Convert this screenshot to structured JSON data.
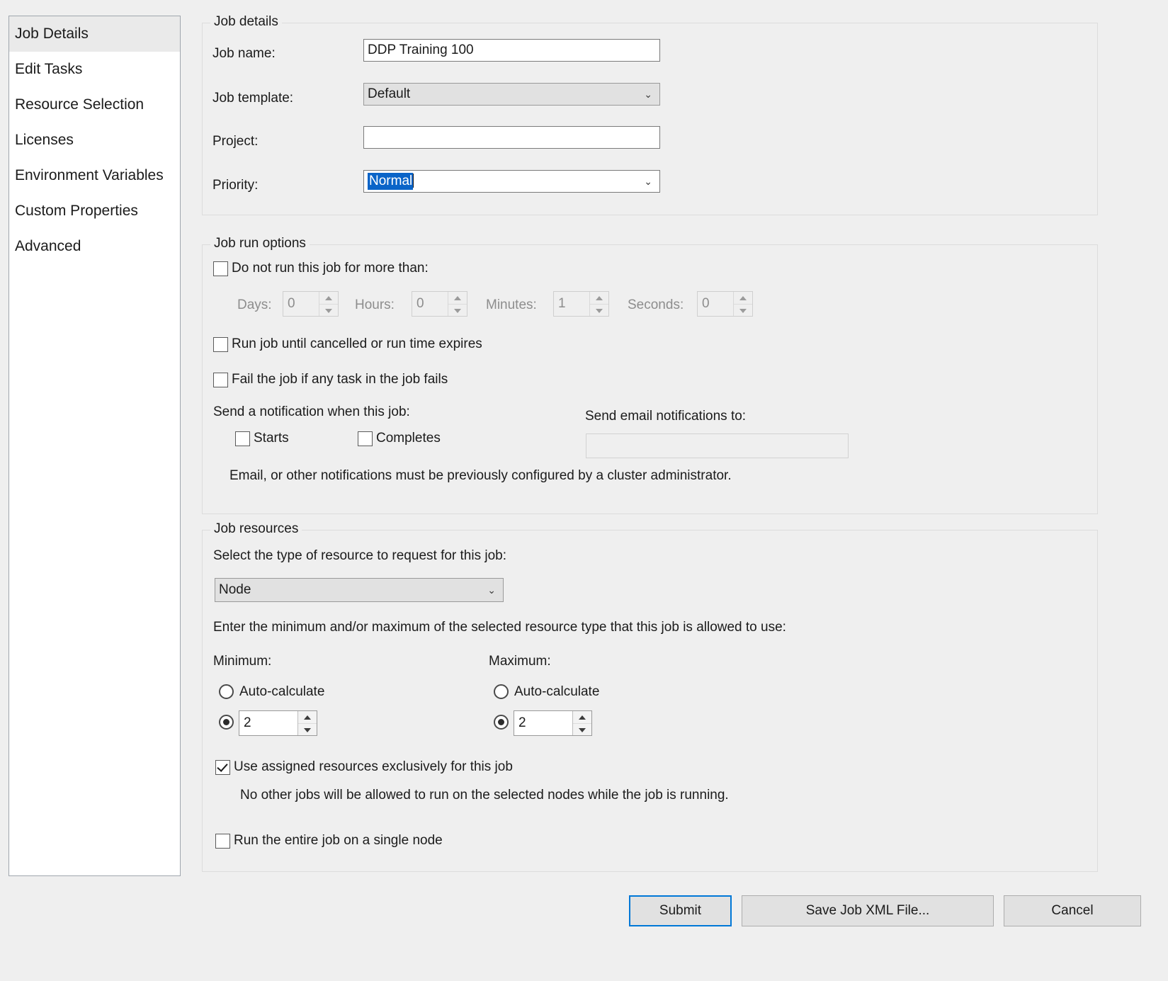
{
  "sidebar": {
    "items": [
      {
        "label": "Job Details",
        "selected": true
      },
      {
        "label": "Edit Tasks",
        "selected": false
      },
      {
        "label": "Resource Selection",
        "selected": false
      },
      {
        "label": "Licenses",
        "selected": false
      },
      {
        "label": "Environment Variables",
        "selected": false
      },
      {
        "label": "Custom Properties",
        "selected": false
      },
      {
        "label": "Advanced",
        "selected": false
      }
    ]
  },
  "job_details": {
    "group_title": "Job details",
    "job_name_label": "Job name:",
    "job_name_value": "DDP Training 100",
    "job_template_label": "Job template:",
    "job_template_value": "Default",
    "project_label": "Project:",
    "project_value": "",
    "priority_label": "Priority:",
    "priority_value": "Normal"
  },
  "job_run_options": {
    "group_title": "Job run options",
    "runtime_limit_label": "Do not run this job for more than:",
    "runtime_limit_checked": false,
    "days_label": "Days:",
    "days_value": "0",
    "hours_label": "Hours:",
    "hours_value": "0",
    "minutes_label": "Minutes:",
    "minutes_value": "1",
    "seconds_label": "Seconds:",
    "seconds_value": "0",
    "run_until_cancelled_label": "Run job until cancelled or run time expires",
    "run_until_cancelled_checked": false,
    "fail_job_label": "Fail the job if any task in the job fails",
    "fail_job_checked": false,
    "notification_label": "Send a notification when this job:",
    "starts_label": "Starts",
    "starts_checked": false,
    "completes_label": "Completes",
    "completes_checked": false,
    "email_to_label": "Send email notifications to:",
    "email_to_value": "",
    "email_note": "Email, or other notifications must be previously configured by a cluster administrator."
  },
  "job_resources": {
    "group_title": "Job resources",
    "resource_type_label": "Select the type of resource to request for this job:",
    "resource_type_value": "Node",
    "minmax_instruction": "Enter the minimum and/or maximum of the selected resource type that this job is allowed to use:",
    "minimum_label": "Minimum:",
    "minimum_auto_label": "Auto-calculate",
    "minimum_auto_selected": false,
    "minimum_value": "2",
    "minimum_value_selected": true,
    "maximum_label": "Maximum:",
    "maximum_auto_label": "Auto-calculate",
    "maximum_auto_selected": false,
    "maximum_value": "2",
    "maximum_value_selected": true,
    "exclusive_label": "Use assigned resources exclusively for this job",
    "exclusive_checked": true,
    "exclusive_note": "No other jobs will be allowed to run on the selected nodes while the job is running.",
    "single_node_label": "Run the entire job on a single node",
    "single_node_checked": false
  },
  "footer": {
    "submit_label": "Submit",
    "save_xml_label": "Save Job XML File...",
    "cancel_label": "Cancel"
  },
  "icons": {
    "chevron_down": "⌄"
  },
  "colors": {
    "accent": "#0078d7",
    "selection": "#0a64c8",
    "window_bg": "#efefef",
    "field_bg": "#ffffff"
  }
}
